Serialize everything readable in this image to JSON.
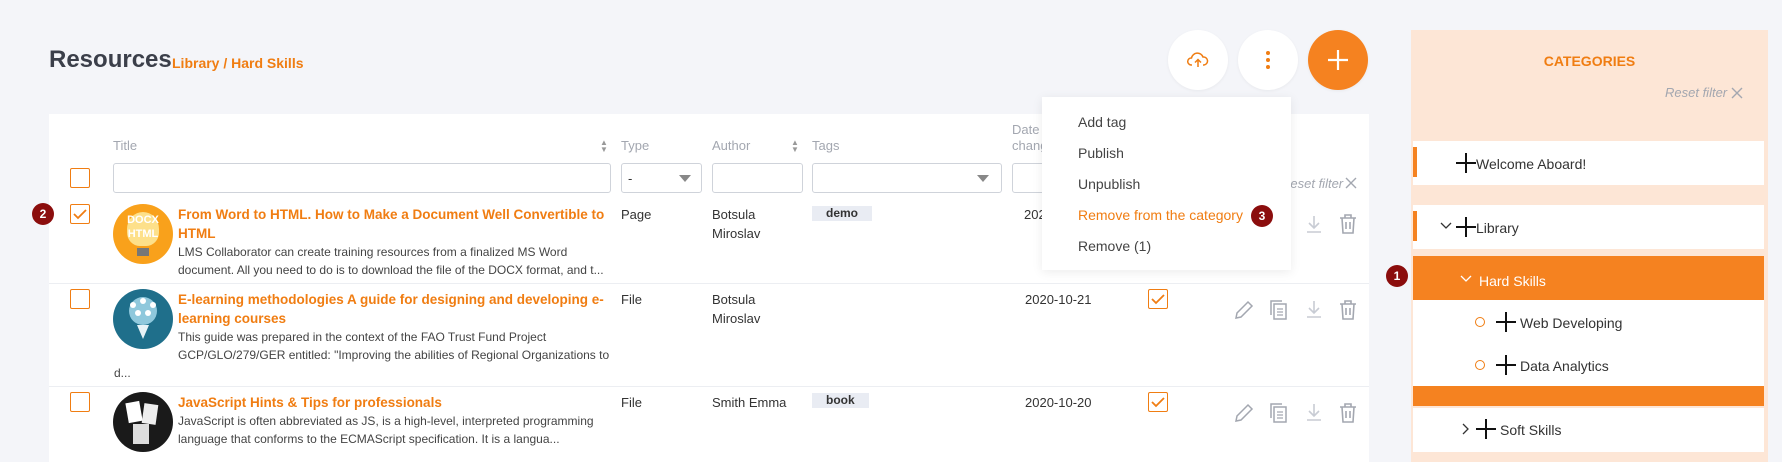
{
  "header": {
    "title": "Resources",
    "breadcrumb": "Library / Hard Skills"
  },
  "table": {
    "columns": {
      "title": "Title",
      "type": "Type",
      "author": "Author",
      "tags": "Tags",
      "date": "Date chang"
    },
    "filters": {
      "type_selected": "-",
      "reset_label": "Reset filter"
    },
    "rows": [
      {
        "title_line1": "From Word to HTML. How to Make a Document Well Convertible to",
        "title_line2": "HTML",
        "desc_line1": "LMS Collaborator can create training resources from a finalized MS Word",
        "desc_line2": "document. All you need to do is to download the file of the DOCX format, and t...",
        "type": "Page",
        "author_line1": "Botsula",
        "author_line2": "Miroslav",
        "tag": "demo",
        "date": "202",
        "thumb_text1": "DOCX",
        "thumb_text2": "HTML",
        "selected": true
      },
      {
        "title_line1": "E-learning methodologies A guide for designing and developing e-",
        "title_line2": "learning courses",
        "desc_line1": "This guide was prepared in the context of the FAO Trust Fund Project",
        "desc_line2": "GCP/GLO/279/GER entitled: \"Improving the abilities of Regional Organizations to",
        "desc_line3": "d...",
        "type": "File",
        "author_line1": "Botsula",
        "author_line2": "Miroslav",
        "date": "2020-10-21",
        "selected": false
      },
      {
        "title_line1": "JavaScript Hints & Tips for professionals",
        "desc_line1": "JavaScript is often abbreviated as JS, is a high-level, interpreted programming",
        "desc_line2": "language that conforms to the ECMAScript specification. It is a langua...",
        "type": "File",
        "author_line1": "Smith Emma",
        "tag": "book",
        "date": "2020-10-20",
        "selected": false
      }
    ]
  },
  "menu": {
    "items": [
      "Add tag",
      "Publish",
      "Unpublish",
      "Remove from the category",
      "Remove (1)"
    ]
  },
  "badges": [
    "1",
    "2",
    "3"
  ],
  "categories": {
    "title": "CATEGORIES",
    "reset_label": "Reset filter",
    "items": [
      "Welcome Aboard!",
      "Library",
      "Hard Skills",
      "Web Developing",
      "Data Analytics",
      "Soft Skills"
    ]
  },
  "colors": {
    "accent": "#f58220",
    "badge": "#8b0d0d"
  }
}
